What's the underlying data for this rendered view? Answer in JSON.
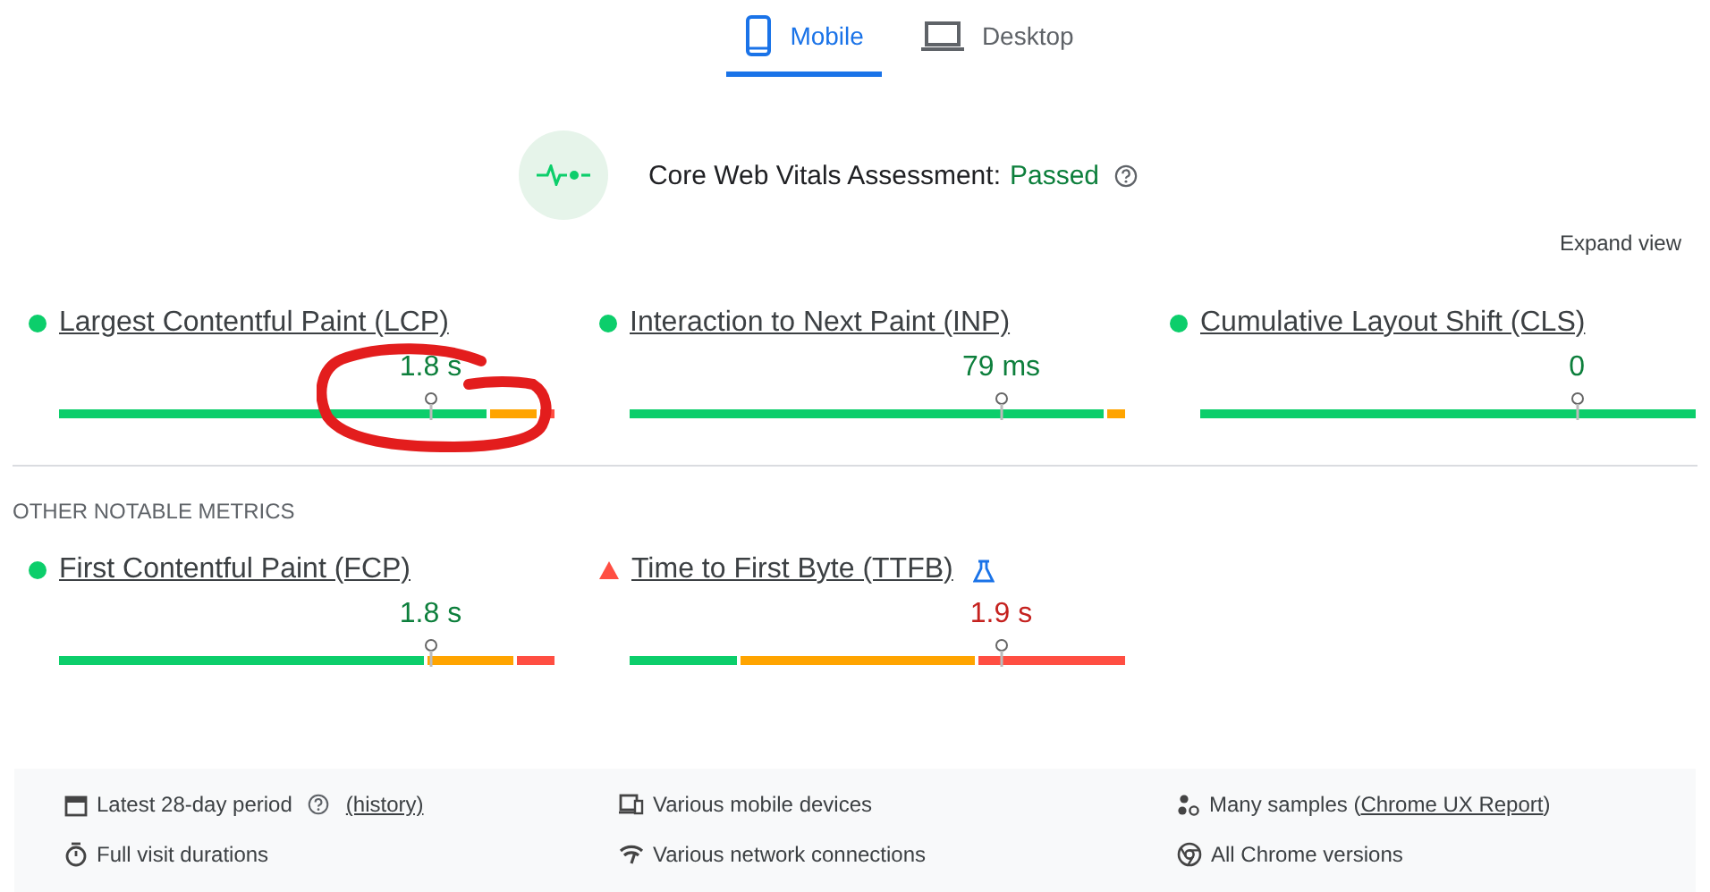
{
  "tabs": [
    {
      "label": "Mobile",
      "selected": true
    },
    {
      "label": "Desktop",
      "selected": false
    }
  ],
  "assessment": {
    "label": "Core Web Vitals Assessment:",
    "result": "Passed"
  },
  "expand_link": "Expand view",
  "core_metrics": [
    {
      "name": "Largest Contentful Paint (LCP)",
      "value": "1.8 s",
      "kind": "good",
      "experimental": false,
      "annotated": true
    },
    {
      "name": "Interaction to Next Paint (INP)",
      "value": "79 ms",
      "kind": "good",
      "experimental": false,
      "annotated": false
    },
    {
      "name": "Cumulative Layout Shift (CLS)",
      "value": "0",
      "kind": "good",
      "experimental": false,
      "annotated": false
    }
  ],
  "other_heading": "OTHER NOTABLE METRICS",
  "other_metrics": [
    {
      "name": "First Contentful Paint (FCP)",
      "value": "1.8 s",
      "kind": "good",
      "experimental": false,
      "annotated": false
    },
    {
      "name": "Time to First Byte (TTFB)",
      "value": "1.9 s",
      "kind": "poor",
      "experimental": true,
      "annotated": false
    }
  ],
  "footer": [
    {
      "text": "Latest 28-day period",
      "help": true,
      "link": "(history)"
    },
    {
      "text": "Various mobile devices",
      "help": false
    },
    {
      "text": "Many samples (",
      "link": "Chrome UX Report",
      "suffix": ")",
      "help": false
    },
    {
      "text": "Full visit durations",
      "help": false
    },
    {
      "text": "Various network connections",
      "help": false
    },
    {
      "text": "All Chrome versions",
      "help": false
    }
  ]
}
